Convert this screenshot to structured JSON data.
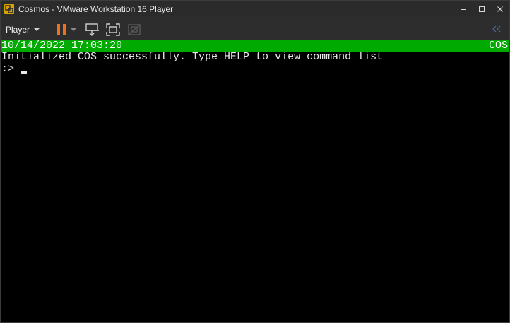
{
  "window": {
    "title": "Cosmos - VMware Workstation 16 Player",
    "app_icon": "vmware-icon",
    "controls": {
      "minimize": "–",
      "maximize": "□",
      "close": "✕"
    }
  },
  "toolbar": {
    "player_label": "Player",
    "icons": [
      "pause-icon",
      "chevron-down-icon",
      "send-ctrl-alt-del-icon",
      "fullscreen-icon",
      "unity-icon",
      "collapse-icon"
    ],
    "colors": {
      "pause": "#f07020",
      "icon": "#cfcfcf",
      "disabled": "#5a5a5a"
    }
  },
  "guest": {
    "status_datetime": "10/14/2022 17:03:20",
    "status_os": "COS",
    "message": "Initialized COS successfully. Type HELP to view command list",
    "prompt": ":>",
    "colors": {
      "statusbar": "#00aa00",
      "background": "#000000",
      "text": "#ffffff"
    }
  }
}
